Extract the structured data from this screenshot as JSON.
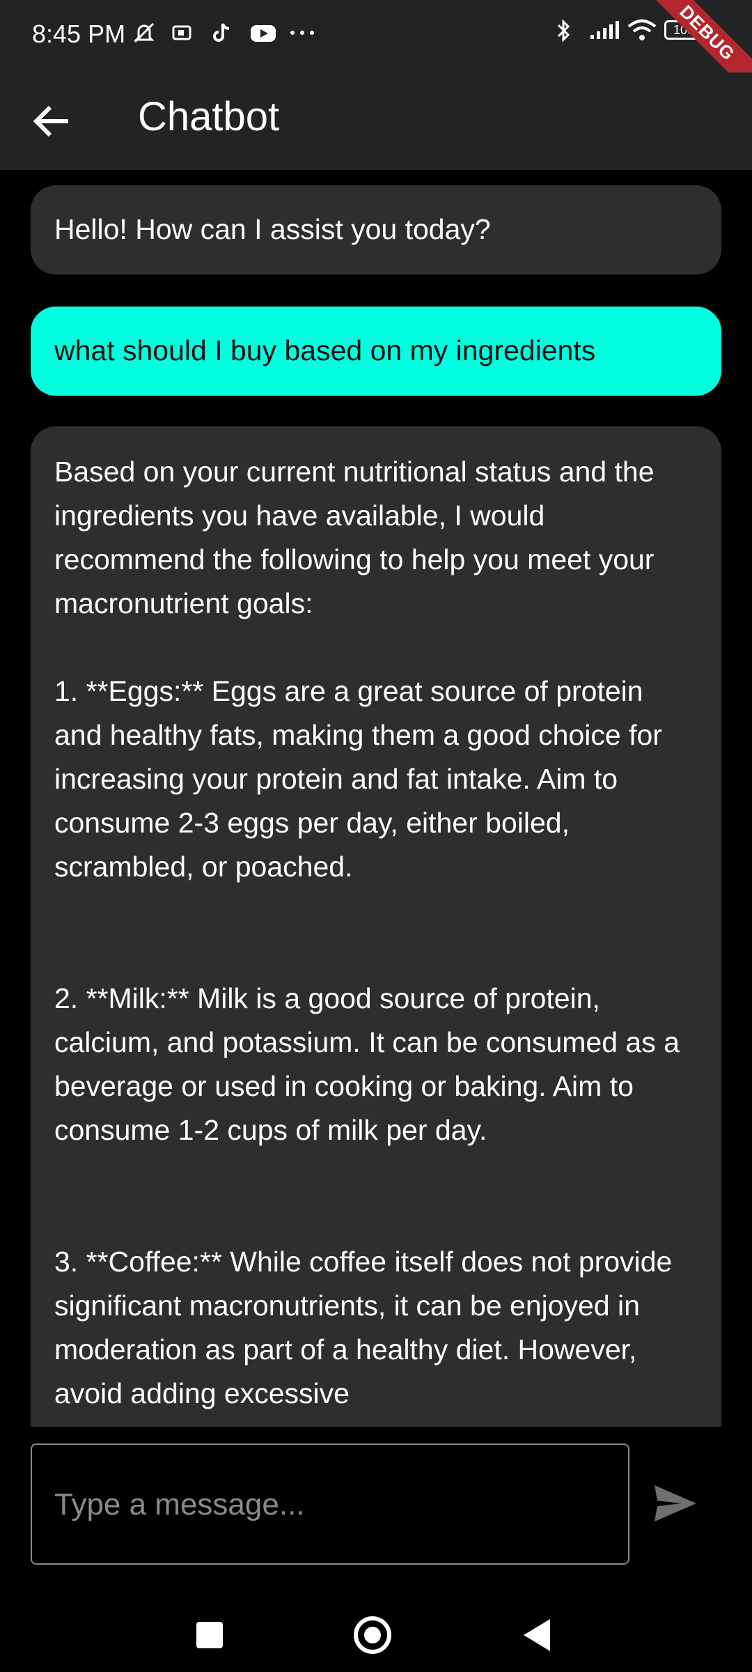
{
  "status_bar": {
    "time": "8:45 PM",
    "left_icons": [
      "mute-icon",
      "screen-record-icon",
      "tiktok-icon",
      "youtube-icon",
      "more-dots-icon"
    ],
    "right_icons": [
      "bluetooth-icon",
      "signal-icon",
      "wifi-icon",
      "battery-icon"
    ],
    "battery_text": "100",
    "debug_banner": "DEBUG"
  },
  "appbar": {
    "title": "Chatbot",
    "back_icon": "arrow-back-icon"
  },
  "messages": [
    {
      "role": "bot",
      "text": "Hello! How can I assist you today?"
    },
    {
      "role": "user",
      "text": "what should I buy based on my ingredients"
    },
    {
      "role": "bot",
      "text": "Based on your current nutritional status and the ingredients you have available, I would recommend the following to help you meet your macronutrient goals:\n\n1. **Eggs:** Eggs are a great source of protein and healthy fats, making them a good choice for increasing your protein and fat intake. Aim to consume 2-3 eggs per day, either boiled, scrambled, or poached.\n\n\n2. **Milk:** Milk is a good source of protein, calcium, and potassium. It can be consumed as a beverage or used in cooking or baking. Aim to consume 1-2 cups of milk per day.\n\n\n3. **Coffee:** While coffee itself does not provide significant macronutrients, it can be enjoyed in moderation as part of a healthy diet. However, avoid adding excessive"
    }
  ],
  "composer": {
    "placeholder": "Type a message...",
    "send_icon": "send-icon"
  },
  "nav": {
    "items": [
      "recents-icon",
      "home-icon",
      "back-icon"
    ]
  }
}
